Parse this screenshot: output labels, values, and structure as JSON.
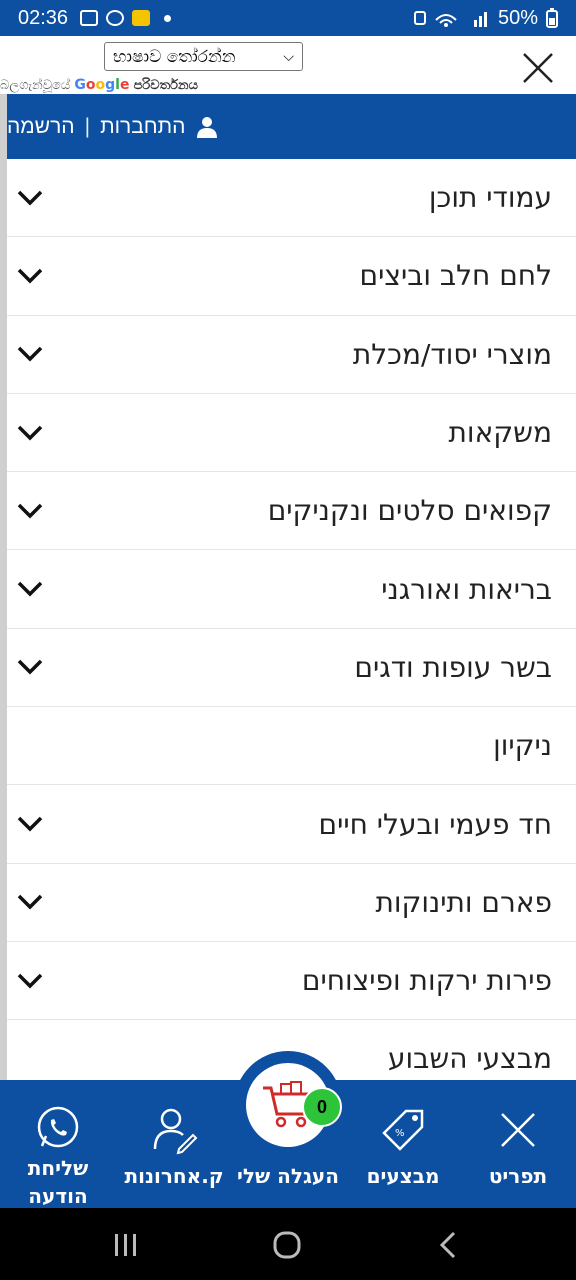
{
  "status_bar": {
    "time": "02:36",
    "battery": "50%"
  },
  "translate": {
    "language_select": "භාෂාව තෝරන්න",
    "powered_prefix": "බලගැන්වූයේ",
    "google": "Google",
    "translate_word": "පරිවර්තනය"
  },
  "login": {
    "login_label": "התחברות",
    "separator": "|",
    "register_label": "הרשמה"
  },
  "menu": {
    "items": [
      {
        "label": "עמודי תוכן",
        "has_chevron": true
      },
      {
        "label": "לחם חלב וביצים",
        "has_chevron": true
      },
      {
        "label": "מוצרי יסוד/מכלת",
        "has_chevron": true
      },
      {
        "label": "משקאות",
        "has_chevron": true
      },
      {
        "label": "קפואים סלטים ונקניקים",
        "has_chevron": true
      },
      {
        "label": "בריאות ואורגני",
        "has_chevron": true
      },
      {
        "label": "בשר עופות ודגים",
        "has_chevron": true
      },
      {
        "label": "ניקיון",
        "has_chevron": false
      },
      {
        "label": "חד פעמי ובעלי חיים",
        "has_chevron": true
      },
      {
        "label": "פארם ותינוקות",
        "has_chevron": true
      },
      {
        "label": "פירות ירקות ופיצוחים",
        "has_chevron": true
      },
      {
        "label": "מבצעי השבוע",
        "has_chevron": false
      }
    ]
  },
  "bottom_nav": {
    "menu_label": "תפריט",
    "deals_label": "מבצעים",
    "cart_label": "העגלה שלי",
    "cart_count": "0",
    "recent_label": "ק.אחרונות",
    "message_line1": "שליחת",
    "message_line2": "הודעה"
  },
  "colors": {
    "primary": "#0d4fa0",
    "badge": "#2ec43a",
    "cart_icon": "#d12a2a"
  }
}
